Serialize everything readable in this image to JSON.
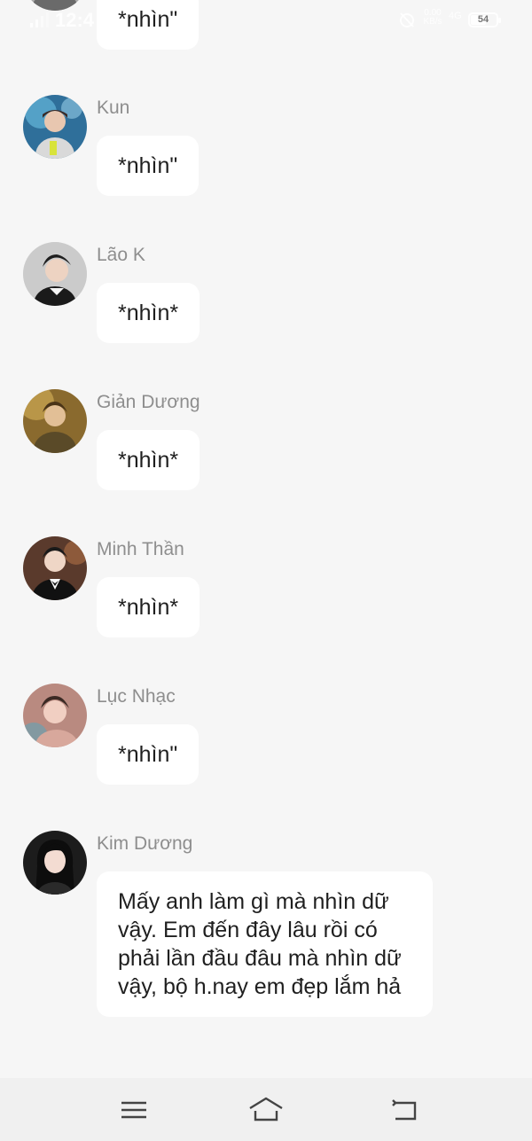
{
  "status_bar": {
    "time": "12:4",
    "net_speed_top": "0.00",
    "net_speed_bottom": "KB/s",
    "network_type": "4G",
    "battery_level": "54"
  },
  "messages": [
    {
      "sender": "",
      "text": "*nhìn\"",
      "avatar_color": "#9a9a9a"
    },
    {
      "sender": "Kun",
      "text": "*nhìn\"",
      "avatar_color": "#3d8fb8"
    },
    {
      "sender": "Lão K",
      "text": "*nhìn*",
      "avatar_color": "#6d6d6d"
    },
    {
      "sender": "Giản Dương",
      "text": "*nhìn*",
      "avatar_color": "#b58a3a"
    },
    {
      "sender": "Minh Thần",
      "text": "*nhìn*",
      "avatar_color": "#6a4a3a"
    },
    {
      "sender": "Lục Nhạc",
      "text": "*nhìn\"",
      "avatar_color": "#b67a6e"
    },
    {
      "sender": "Kim Dương",
      "text": "Mấy anh làm gì mà nhìn dữ vậy. Em đến đây lâu rồi có phải lần đầu đâu mà nhìn dữ vậy, bộ h.nay em đẹp lắm hả",
      "avatar_color": "#2a2a2a"
    }
  ],
  "nav_bar": {
    "buttons": [
      "menu-icon",
      "home-icon",
      "back-icon"
    ]
  }
}
